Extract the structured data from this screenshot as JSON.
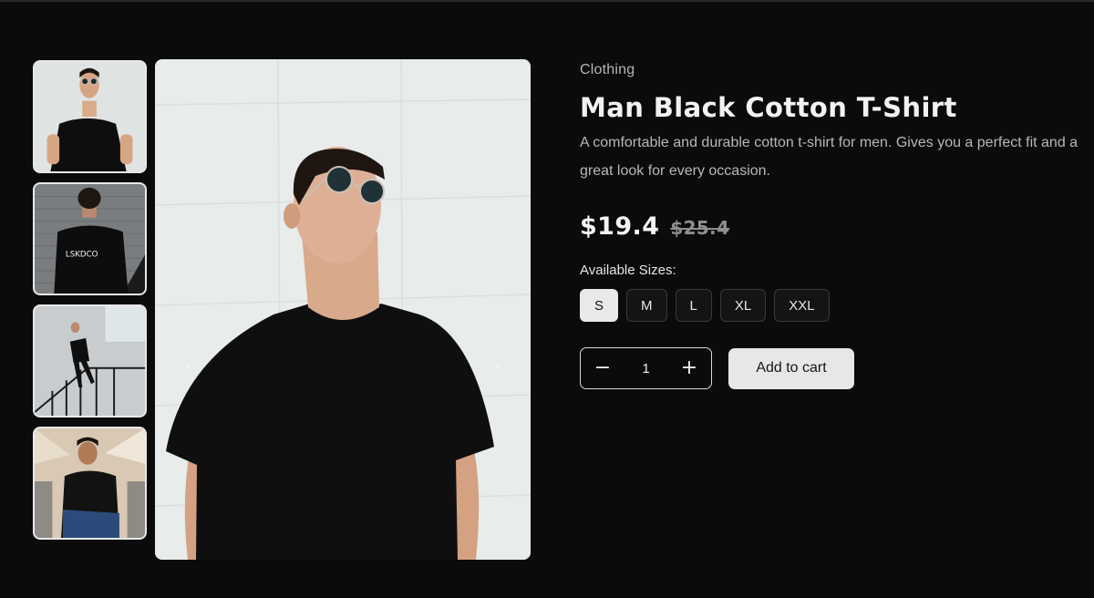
{
  "product": {
    "category": "Clothing",
    "title": "Man Black Cotton T-Shirt",
    "description": "A comfortable and durable cotton t-shirt for men. Gives you a perfect fit and a great look for every occasion.",
    "price": "$19.4",
    "old_price": "$25.4"
  },
  "sizes": {
    "label": "Available Sizes:",
    "options": [
      "S",
      "M",
      "L",
      "XL",
      "XXL"
    ],
    "selected": "S"
  },
  "cart": {
    "quantity": "1",
    "decrement_symbol": "−",
    "increment_symbol": "+",
    "add_label": "Add to cart"
  },
  "gallery": {
    "shirt_print": "LSKDCO",
    "prev_icon": "‹",
    "next_icon": "›"
  },
  "colors": {
    "background": "#0b0b0c",
    "accent": "#e9e9ea"
  }
}
